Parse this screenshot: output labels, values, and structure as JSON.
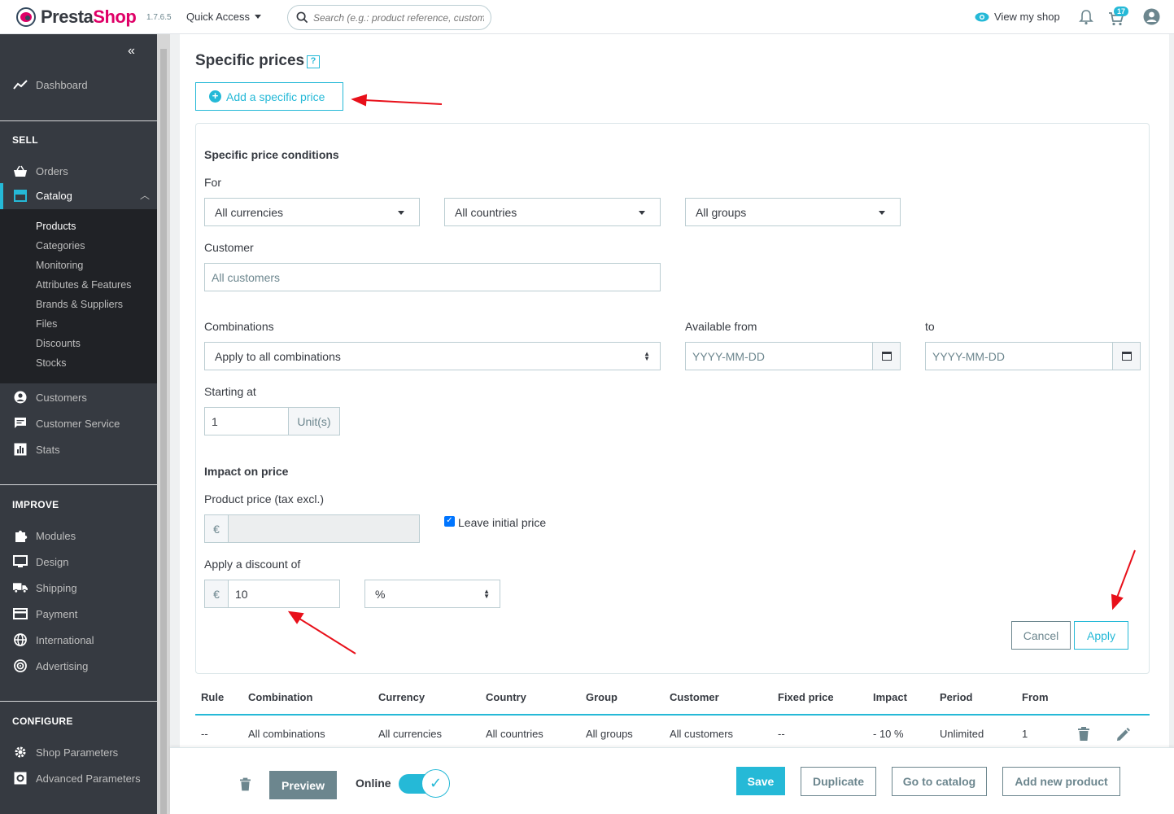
{
  "header": {
    "logo_prefix": "Presta",
    "logo_suffix": "Shop",
    "version": "1.7.6.5",
    "quick_access": "Quick Access",
    "search_placeholder": "Search (e.g.: product reference, customer name...)",
    "view_shop": "View my shop",
    "notification_count": "17"
  },
  "sidebar": {
    "dashboard": "Dashboard",
    "sell_title": "SELL",
    "orders": "Orders",
    "catalog": "Catalog",
    "catalog_sub": [
      "Products",
      "Categories",
      "Monitoring",
      "Attributes & Features",
      "Brands & Suppliers",
      "Files",
      "Discounts",
      "Stocks"
    ],
    "customers": "Customers",
    "customer_service": "Customer Service",
    "stats": "Stats",
    "improve_title": "IMPROVE",
    "improve": [
      "Modules",
      "Design",
      "Shipping",
      "Payment",
      "International",
      "Advertising"
    ],
    "configure_title": "CONFIGURE",
    "configure": [
      "Shop Parameters",
      "Advanced Parameters"
    ]
  },
  "content": {
    "title": "Specific prices",
    "help": "?",
    "add_button": "Add a specific price",
    "conditions_title": "Specific price conditions",
    "for_label": "For",
    "currency": "All currencies",
    "country": "All countries",
    "group": "All groups",
    "customer_label": "Customer",
    "customer_placeholder": "All customers",
    "combinations_label": "Combinations",
    "combinations_value": "Apply to all combinations",
    "available_from_label": "Available from",
    "to_label": "to",
    "date_placeholder": "YYYY-MM-DD",
    "starting_at_label": "Starting at",
    "starting_at_value": "1",
    "unit_label": "Unit(s)",
    "impact_title": "Impact on price",
    "product_price_label": "Product price (tax excl.)",
    "currency_symbol": "€",
    "leave_initial": "Leave initial price",
    "discount_label": "Apply a discount of",
    "discount_value": "10",
    "discount_type": "%",
    "cancel": "Cancel",
    "apply": "Apply"
  },
  "table": {
    "headers": [
      "Rule",
      "Combination",
      "Currency",
      "Country",
      "Group",
      "Customer",
      "Fixed price",
      "Impact",
      "Period",
      "From"
    ],
    "row": [
      "--",
      "All combinations",
      "All currencies",
      "All countries",
      "All groups",
      "All customers",
      "--",
      "- 10 %",
      "Unlimited",
      "1"
    ]
  },
  "footer": {
    "preview": "Preview",
    "online": "Online",
    "save": "Save",
    "duplicate": "Duplicate",
    "go_catalog": "Go to catalog",
    "add_new": "Add new product"
  },
  "colors": {
    "accent": "#25b9d7",
    "sidebar_bg": "#363a41",
    "annotation": "#e8101a"
  }
}
